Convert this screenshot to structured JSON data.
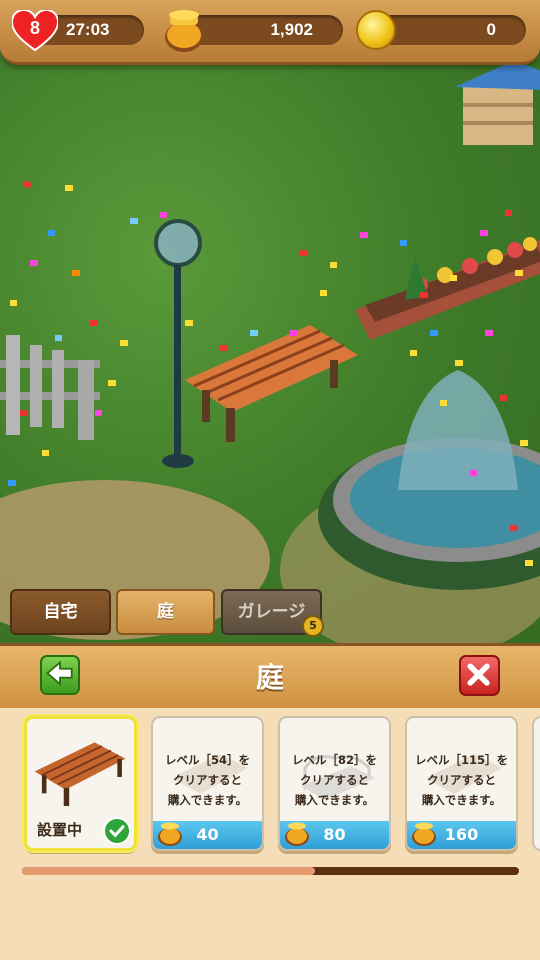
{
  "hud": {
    "lives": "8",
    "timer": "27:03",
    "honey": "1,902",
    "coins": "0"
  },
  "location_tabs": {
    "home": "自宅",
    "garden": "庭",
    "garage": "ガレージ",
    "garage_lock_badge": "5"
  },
  "panel": {
    "title": "庭",
    "progress": 0.59
  },
  "items": [
    {
      "status": "設置中"
    },
    {
      "req_line1": "レベル［54］を",
      "req_line2": "クリアすると",
      "req_line3": "購入できます。",
      "price": "40"
    },
    {
      "req_line1": "レベル［82］を",
      "req_line2": "クリアすると",
      "req_line3": "購入できます。",
      "price": "80"
    },
    {
      "req_line1": "レベル［115］を",
      "req_line2": "クリアすると",
      "req_line3": "購入できます。",
      "price": "160"
    }
  ],
  "colors": {
    "accent_wood": "#cf9141",
    "price_blue": "#2f9fd6",
    "check_green": "#2fa43a",
    "close_red": "#c8211f",
    "back_green": "#3c9a1e"
  }
}
